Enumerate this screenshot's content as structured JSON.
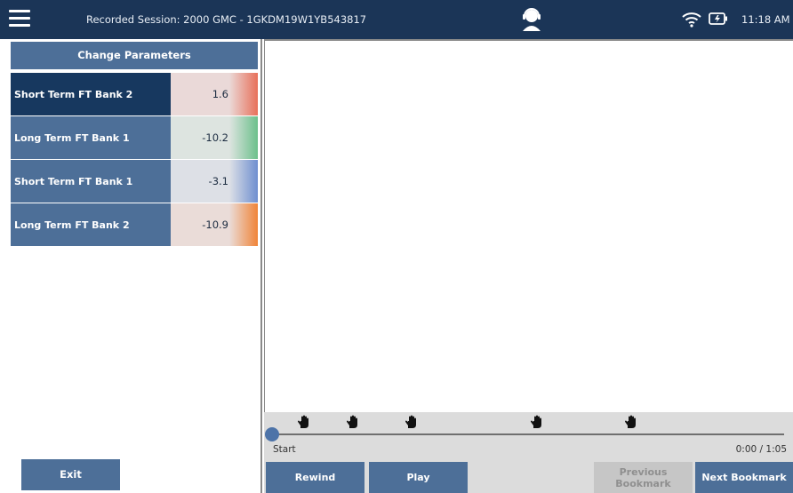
{
  "header": {
    "title": "Recorded Session: 2000 GMC - 1GKDM19W1YB543817",
    "time": "11:18 AM"
  },
  "left": {
    "change_parameters_label": "Change Parameters",
    "params": [
      {
        "name": "Short Term FT Bank 2",
        "value": "1.6",
        "color": "#e8705a",
        "selected": true
      },
      {
        "name": "Long Term FT Bank 1",
        "value": "-10.2",
        "color": "#6cc08b",
        "selected": false
      },
      {
        "name": "Short Term FT Bank 1",
        "value": "-3.1",
        "color": "#6f8fd0",
        "selected": false
      },
      {
        "name": "Long Term FT Bank 2",
        "value": "-10.9",
        "color": "#f08438",
        "selected": false
      }
    ],
    "exit_label": "Exit"
  },
  "timeline": {
    "start_label": "Start",
    "time_readout": "0:00 / 1:05",
    "bookmark_count": 5
  },
  "controls": {
    "rewind_label": "Rewind",
    "play_label": "Play",
    "prev_bookmark_label": "Previous Bookmark",
    "next_bookmark_label": "Next Bookmark"
  },
  "colors": {
    "topbar": "#1b3557",
    "button": "#4d6f98",
    "selected": "#17385f",
    "disabled": "#c6c6c6"
  }
}
